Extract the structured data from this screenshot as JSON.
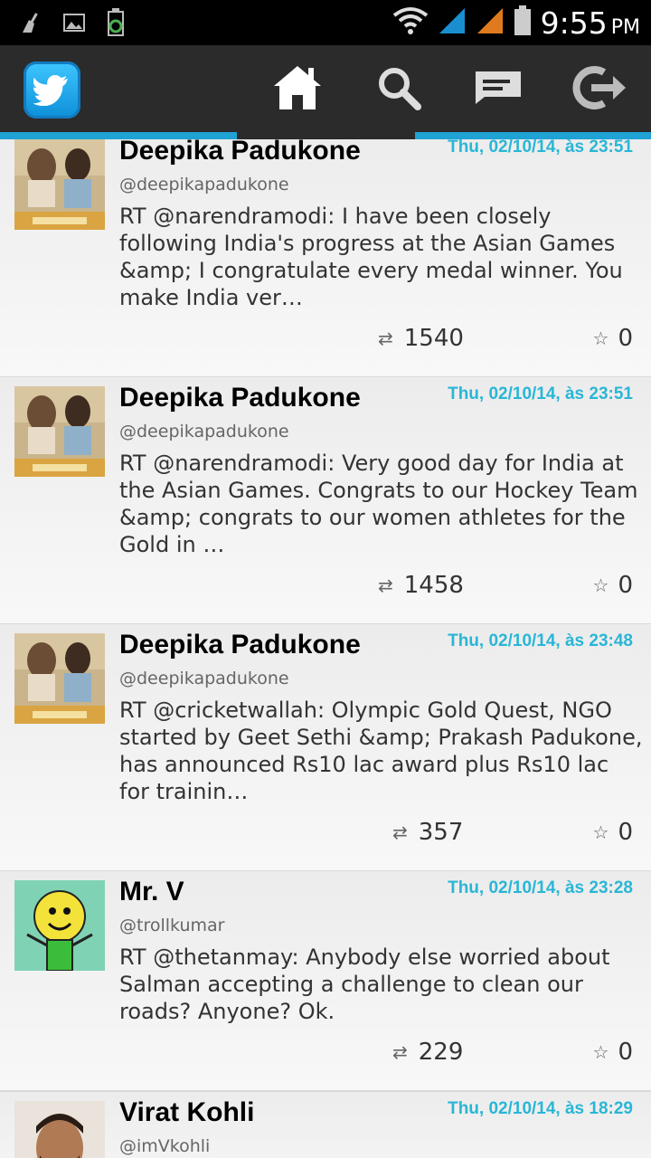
{
  "status_bar": {
    "time": "9:55",
    "ampm": "PM"
  },
  "tweets": [
    {
      "name": "Deepika Padukone",
      "handle": "@deepikapadukone",
      "date": "Thu, 02/10/14, às 23:51",
      "text": "RT @narendramodi: I have been closely following India's progress at the Asian Games &amp; I congratulate every medal winner. You make India ver…",
      "retweets": "1540",
      "favorites": "0"
    },
    {
      "name": "Deepika Padukone",
      "handle": "@deepikapadukone",
      "date": "Thu, 02/10/14, às 23:51",
      "text": "RT @narendramodi: Very good day for India at the Asian Games. Congrats to our Hockey Team &amp; congrats to our women athletes for the Gold in …",
      "retweets": "1458",
      "favorites": "0"
    },
    {
      "name": "Deepika Padukone",
      "handle": "@deepikapadukone",
      "date": "Thu, 02/10/14, às 23:48",
      "text": "RT @cricketwallah: Olympic Gold Quest, NGO started by Geet Sethi &amp; Prakash Padukone, has announced Rs10 lac award plus Rs10 lac for trainin…",
      "retweets": "357",
      "favorites": "0"
    },
    {
      "name": "Mr. V",
      "handle": "@trollkumar",
      "date": "Thu, 02/10/14, às 23:28",
      "text": "RT @thetanmay: Anybody else worried about Salman accepting a challenge to clean our roads? Anyone? Ok.",
      "retweets": "229",
      "favorites": "0"
    },
    {
      "name": "Virat Kohli",
      "handle": "@imVkohli",
      "date": "Thu, 02/10/14, às 18:29",
      "text": "",
      "retweets": "",
      "favorites": ""
    }
  ],
  "colors": {
    "accent": "#1fa2d4",
    "date": "#29b6d6",
    "actionbar": "#2b2b2b"
  }
}
